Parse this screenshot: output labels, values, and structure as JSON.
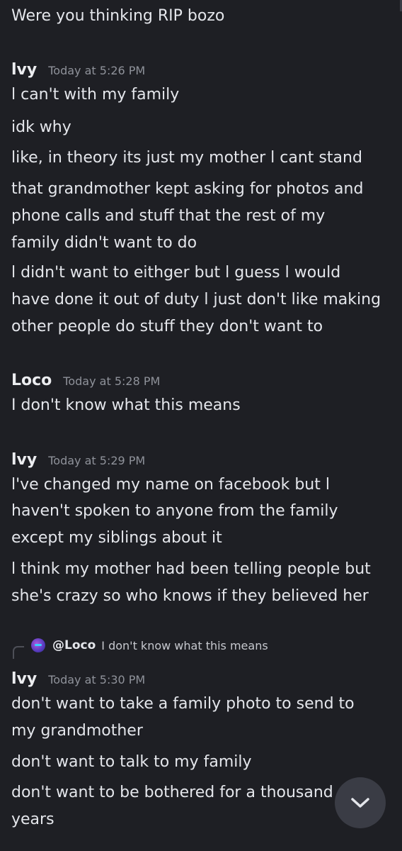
{
  "messages": [
    {
      "lines": [
        "Were you thinking RIP bozo"
      ]
    },
    {
      "author": "lvy",
      "timestamp": "Today at 5:26 PM",
      "lines": [
        "l can't with my family",
        "idk why",
        "like, in theory its just my mother l cant stand",
        "that grandmother kept asking for photos and",
        "phone calls and stuff that the rest of my",
        "family didn't want to do",
        "l didn't want to eithger but l guess l would",
        "have done it out of duty l just don't like making",
        "other people do stuff they don't want to"
      ]
    },
    {
      "author": "Loco",
      "timestamp": "Today at 5:28 PM",
      "lines": [
        "I don't know what this means"
      ]
    },
    {
      "author": "lvy",
      "timestamp": "Today at 5:29 PM",
      "lines": [
        "l've changed my name on facebook but l",
        "haven't spoken to anyone from the family",
        "except my siblings about it",
        "l think my mother had been telling people but",
        "she's crazy so who knows if they believed her"
      ]
    },
    {
      "reply": {
        "author": "@Loco",
        "text": "I don't know what this means"
      },
      "author": "lvy",
      "timestamp": "Today at 5:30 PM",
      "lines": [
        "don't want to take a family photo to send to",
        "my grandmother",
        "don't want to talk to my family",
        "don't want to be bothered for a thousand",
        "years"
      ]
    }
  ],
  "scroll_button": {
    "icon": "chevron-down-icon"
  },
  "colors": {
    "background": "#1e1f24",
    "text": "#e4e6eb",
    "timestamp": "#8f929a",
    "scroll_button": "#3a3c45"
  }
}
